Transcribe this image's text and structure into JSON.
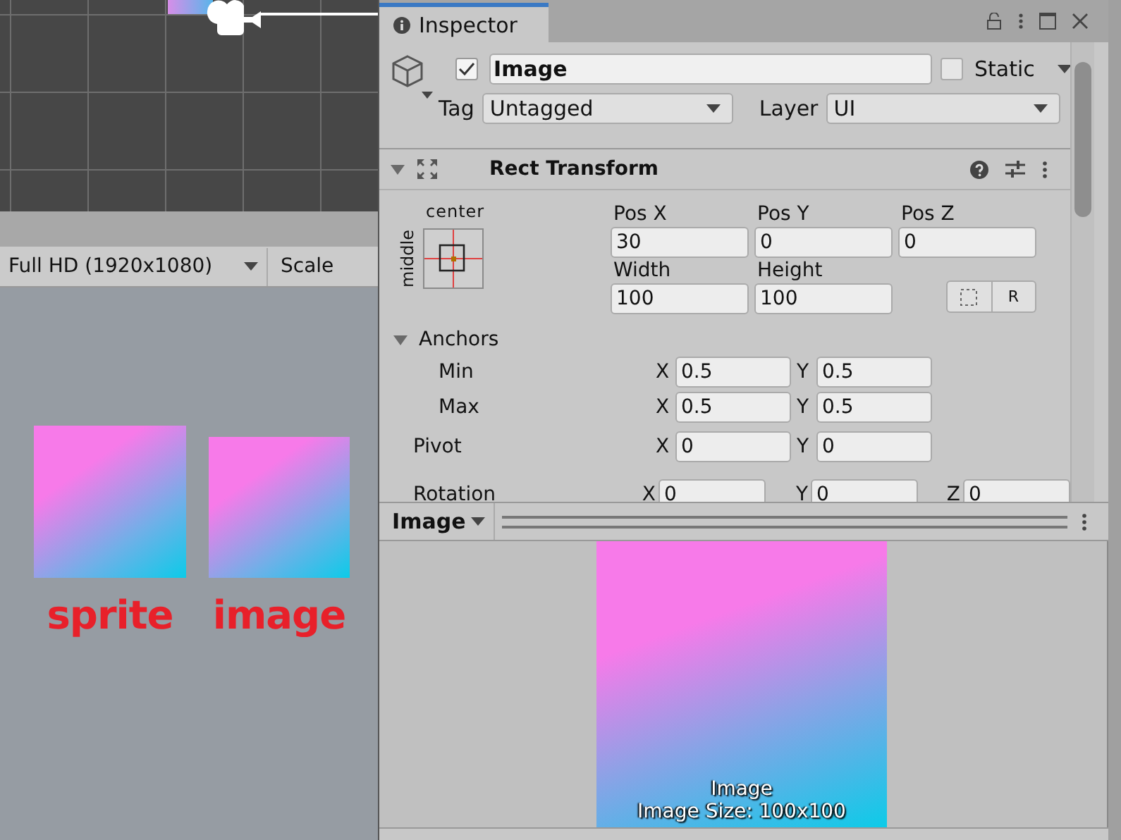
{
  "game_toolbar": {
    "resolution": "Full HD (1920x1080)",
    "scale_label": "Scale"
  },
  "game_view": {
    "items": [
      {
        "label": "sprite"
      },
      {
        "label": "image"
      }
    ]
  },
  "inspector": {
    "tab": "Inspector",
    "active": true,
    "enabled": true,
    "name": "Image",
    "static": false,
    "static_label": "Static",
    "tag_label": "Tag",
    "tag": "Untagged",
    "layer_label": "Layer",
    "layer": "UI"
  },
  "rect_transform": {
    "title": "Rect Transform",
    "expanded": true,
    "anchor_h": "center",
    "anchor_v": "middle",
    "position": [
      {
        "label": "Pos X",
        "value": "30"
      },
      {
        "label": "Pos Y",
        "value": "0"
      },
      {
        "label": "Pos Z",
        "value": "0"
      }
    ],
    "size": [
      {
        "label": "Width",
        "value": "100"
      },
      {
        "label": "Height",
        "value": "100"
      }
    ],
    "raw_button": "R",
    "anchors": {
      "label": "Anchors",
      "expanded": true,
      "rows": [
        {
          "label": "Min",
          "values": [
            {
              "axis": "X",
              "value": "0.5"
            },
            {
              "axis": "Y",
              "value": "0.5"
            }
          ]
        },
        {
          "label": "Max",
          "values": [
            {
              "axis": "X",
              "value": "0.5"
            },
            {
              "axis": "Y",
              "value": "0.5"
            }
          ]
        }
      ]
    },
    "pivot": {
      "label": "Pivot",
      "values": [
        {
          "axis": "X",
          "value": "0"
        },
        {
          "axis": "Y",
          "value": "0"
        }
      ]
    },
    "rotation": {
      "label": "Rotation",
      "values": [
        {
          "axis": "X",
          "value": "0"
        },
        {
          "axis": "Y",
          "value": "0"
        },
        {
          "axis": "Z",
          "value": "0"
        }
      ]
    }
  },
  "preview": {
    "title": "Image",
    "caption": "Image",
    "size": "Image Size: 100x100"
  }
}
